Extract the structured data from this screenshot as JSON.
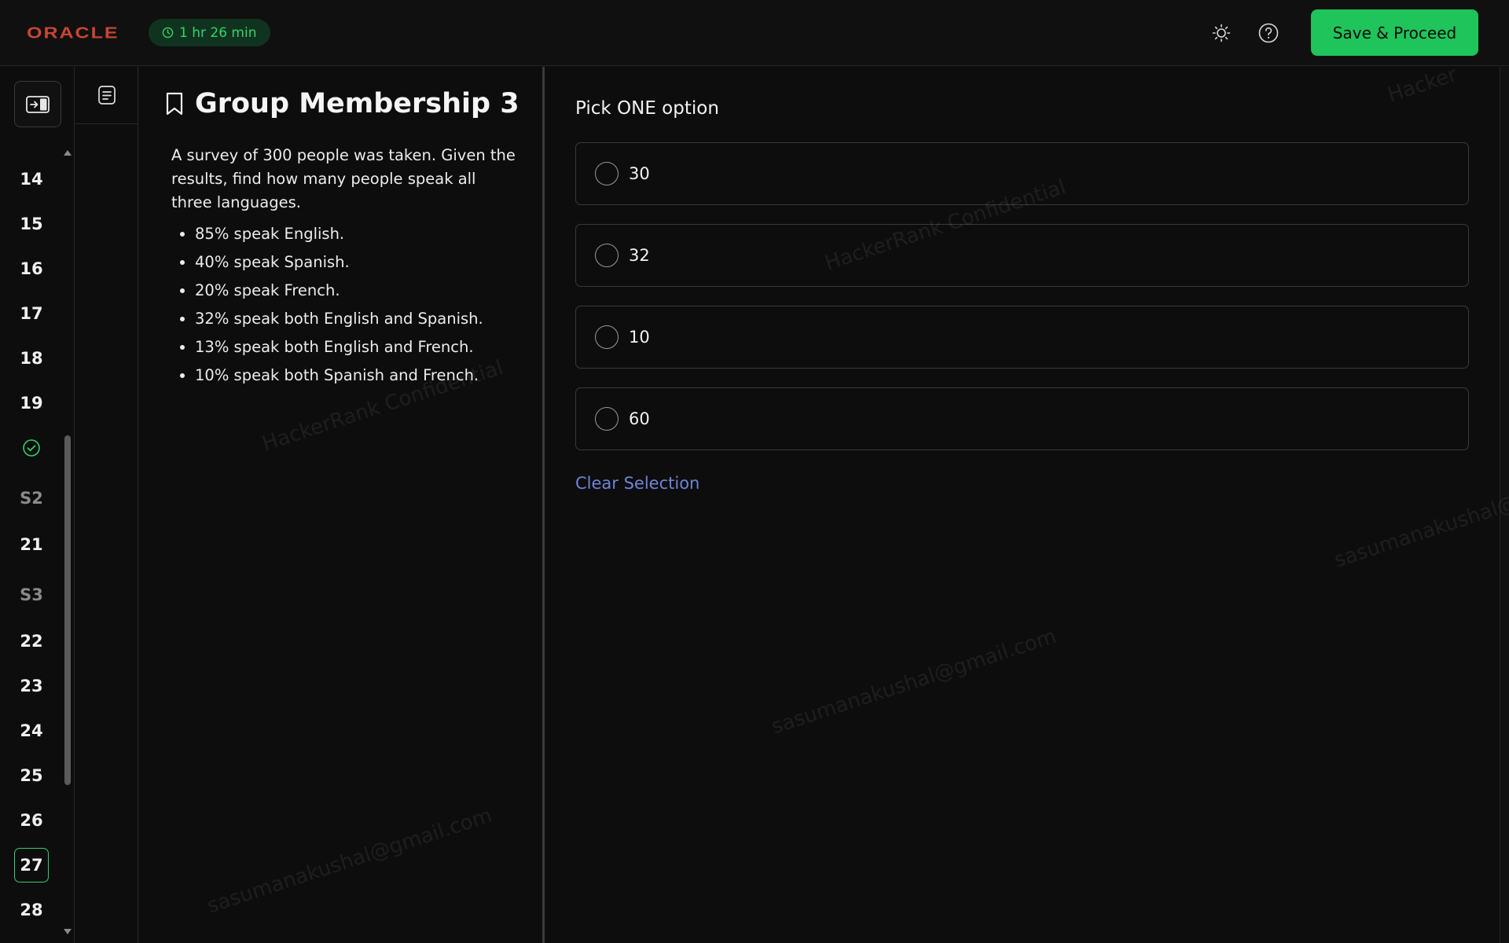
{
  "header": {
    "logo": "ORACLE",
    "timer": "1 hr 26 min",
    "theme_icon": "sun-icon",
    "help_icon": "help-icon",
    "save_label": "Save & Proceed"
  },
  "rail": {
    "toggle_icon": "sidebar-toggle-icon",
    "items": [
      {
        "label": "14",
        "kind": "question"
      },
      {
        "label": "15",
        "kind": "question"
      },
      {
        "label": "16",
        "kind": "question"
      },
      {
        "label": "17",
        "kind": "question"
      },
      {
        "label": "18",
        "kind": "question"
      },
      {
        "label": "19",
        "kind": "question"
      },
      {
        "label": "",
        "kind": "answered"
      },
      {
        "label": "S2",
        "kind": "section"
      },
      {
        "label": "21",
        "kind": "question"
      },
      {
        "label": "S3",
        "kind": "section"
      },
      {
        "label": "22",
        "kind": "question"
      },
      {
        "label": "23",
        "kind": "question"
      },
      {
        "label": "24",
        "kind": "question"
      },
      {
        "label": "25",
        "kind": "question"
      },
      {
        "label": "26",
        "kind": "question"
      },
      {
        "label": "27",
        "kind": "current"
      },
      {
        "label": "28",
        "kind": "question"
      }
    ]
  },
  "question": {
    "title": "Group Membership 3",
    "intro": "A survey of 300 people was taken. Given the results, find how many people speak all three languages.",
    "bullets": [
      "85% speak English.",
      "40% speak Spanish.",
      "20% speak French.",
      "32% speak both English and Spanish.",
      "13% speak both English and French.",
      "10% speak both Spanish and French."
    ]
  },
  "answers": {
    "instruction": "Pick ONE option",
    "options": [
      "30",
      "32",
      "10",
      "60"
    ],
    "clear_label": "Clear Selection"
  },
  "watermarks": [
    "HackerRank Confidential",
    "HackerRank Confidential",
    "sasumanakushal@gmail.com",
    "sasumanakushal@gmail.com",
    "sasumanakushal@",
    "Hacker"
  ],
  "colors": {
    "accent_green": "#1fc45b",
    "brand_red": "#c74634",
    "link_blue": "#6e84d6"
  }
}
